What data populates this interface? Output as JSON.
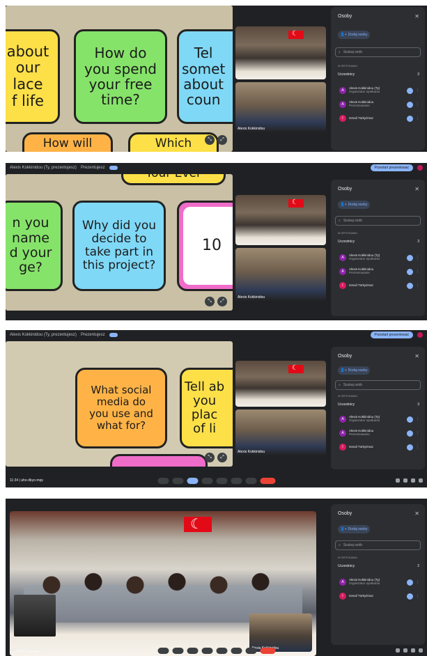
{
  "shots": [
    {
      "topbar": null,
      "stage": {
        "cards": [
          {
            "text": "about\nour\nlace\nf life",
            "color": "yellow"
          },
          {
            "text": "How do\nyou spend\nyour free\ntime?",
            "color": "green"
          },
          {
            "text": "Tel\nsomet\nabout\ncoun",
            "color": "blue"
          },
          {
            "text": "How will",
            "color": "orange"
          },
          {
            "text": "Which",
            "color": "yellow"
          }
        ]
      },
      "tiles": [
        {
          "kind": "class",
          "name": ""
        },
        {
          "kind": "boy",
          "name": "Alexis Kokkinidou"
        }
      ],
      "panel": {
        "title": "Osoby",
        "add_label": "Dodaj osoby",
        "search_placeholder": "Szukaj osób",
        "section_label": "W SPOTKANIU",
        "group_label": "Uczestnicy",
        "group_count": "3",
        "participants": [
          {
            "initial": "A",
            "name": "Alexis Kokkinidou (Ty)",
            "sub": "Organizator spotkania"
          },
          {
            "initial": "A",
            "name": "Alexis Kokkinidou",
            "sub": "Prezentowanie"
          },
          {
            "initial": "I",
            "name": "Ismail Türkyılmaz",
            "sub": ""
          }
        ]
      },
      "bottom": null
    },
    {
      "topbar": {
        "title": "Alexis Kokkinidou (Ty, prezentujesz)",
        "status": "Prezentujesz",
        "present_label": "Przestań prezentować"
      },
      "stage": {
        "cards": [
          {
            "text": "Your Ever",
            "color": "yellow"
          },
          {
            "text": "n you\nname\nd your\nge?",
            "color": "green"
          },
          {
            "text": "Why did you\ndecide to\ntake part in\nthis project?",
            "color": "blue"
          },
          {
            "text": "10",
            "color": "white"
          }
        ]
      },
      "tiles": [
        {
          "kind": "class",
          "name": ""
        },
        {
          "kind": "boy",
          "name": "Alexis Kokkinidou"
        }
      ],
      "panel": {
        "title": "Osoby",
        "add_label": "Dodaj osoby",
        "search_placeholder": "Szukaj osób",
        "section_label": "W SPOTKANIU",
        "group_label": "Uczestnicy",
        "group_count": "3",
        "participants": [
          {
            "initial": "A",
            "name": "Alexis Kokkinidou (Ty)",
            "sub": "Organizator spotkania"
          },
          {
            "initial": "A",
            "name": "Alexis Kokkinidou",
            "sub": "Prezentowanie"
          },
          {
            "initial": "I",
            "name": "Ismail Türkyılmaz",
            "sub": ""
          }
        ]
      },
      "bottom": null
    },
    {
      "topbar": {
        "title": "Alexis Kokkinidou (Ty, prezentujesz)",
        "status": "Prezentujesz",
        "present_label": "Przestań prezentować"
      },
      "stage": {
        "cards": [
          {
            "text": "What social\nmedia do\nyou use and\nwhat for?",
            "color": "orange"
          },
          {
            "text": "Tell ab\nyou\nplac\nof li",
            "color": "yellow"
          }
        ]
      },
      "tiles": [
        {
          "kind": "class",
          "name": ""
        },
        {
          "kind": "boy",
          "name": "Alexis Kokkinidou"
        }
      ],
      "panel": {
        "title": "Osoby",
        "add_label": "Dodaj osoby",
        "search_placeholder": "Szukaj osób",
        "section_label": "W SPOTKANIU",
        "group_label": "Uczestnicy",
        "group_count": "3",
        "participants": [
          {
            "initial": "A",
            "name": "Alexis Kokkinidou (Ty)",
            "sub": "Organizator spotkania"
          },
          {
            "initial": "A",
            "name": "Alexis Kokkinidou",
            "sub": "Prezentowanie"
          },
          {
            "initial": "I",
            "name": "Ismail Türkyılmaz",
            "sub": ""
          }
        ]
      },
      "bottom": {
        "time": "11:34",
        "code": "aho-dkyo-mqs"
      }
    },
    {
      "topbar": null,
      "main_name": "Ismail Türkyılmaz",
      "pip_name": "Alexis Kokkinidou",
      "panel": {
        "title": "Osoby",
        "add_label": "Dodaj osoby",
        "search_placeholder": "Szukaj osób",
        "section_label": "W SPOTKANIU",
        "group_label": "Uczestnicy",
        "group_count": "2",
        "participants": [
          {
            "initial": "A",
            "name": "Alexis Kokkinidou (Ty)",
            "sub": "Organizator spotkania"
          },
          {
            "initial": "I",
            "name": "Ismail Türkyılmaz",
            "sub": ""
          }
        ]
      },
      "bottom": {
        "time": "11:51",
        "code": "aho-dkyo-mqs"
      }
    }
  ],
  "icons": {
    "close": "close-icon",
    "add_person": "add-person-icon",
    "search": "search-icon",
    "mic": "mic-icon",
    "more": "more-vert-icon",
    "end_call": "end-call-icon"
  },
  "colors": {
    "meet_bg": "#202124",
    "panel_bg": "#2d2e31",
    "accent": "#8ab4f8",
    "end_call": "#ea4335"
  }
}
